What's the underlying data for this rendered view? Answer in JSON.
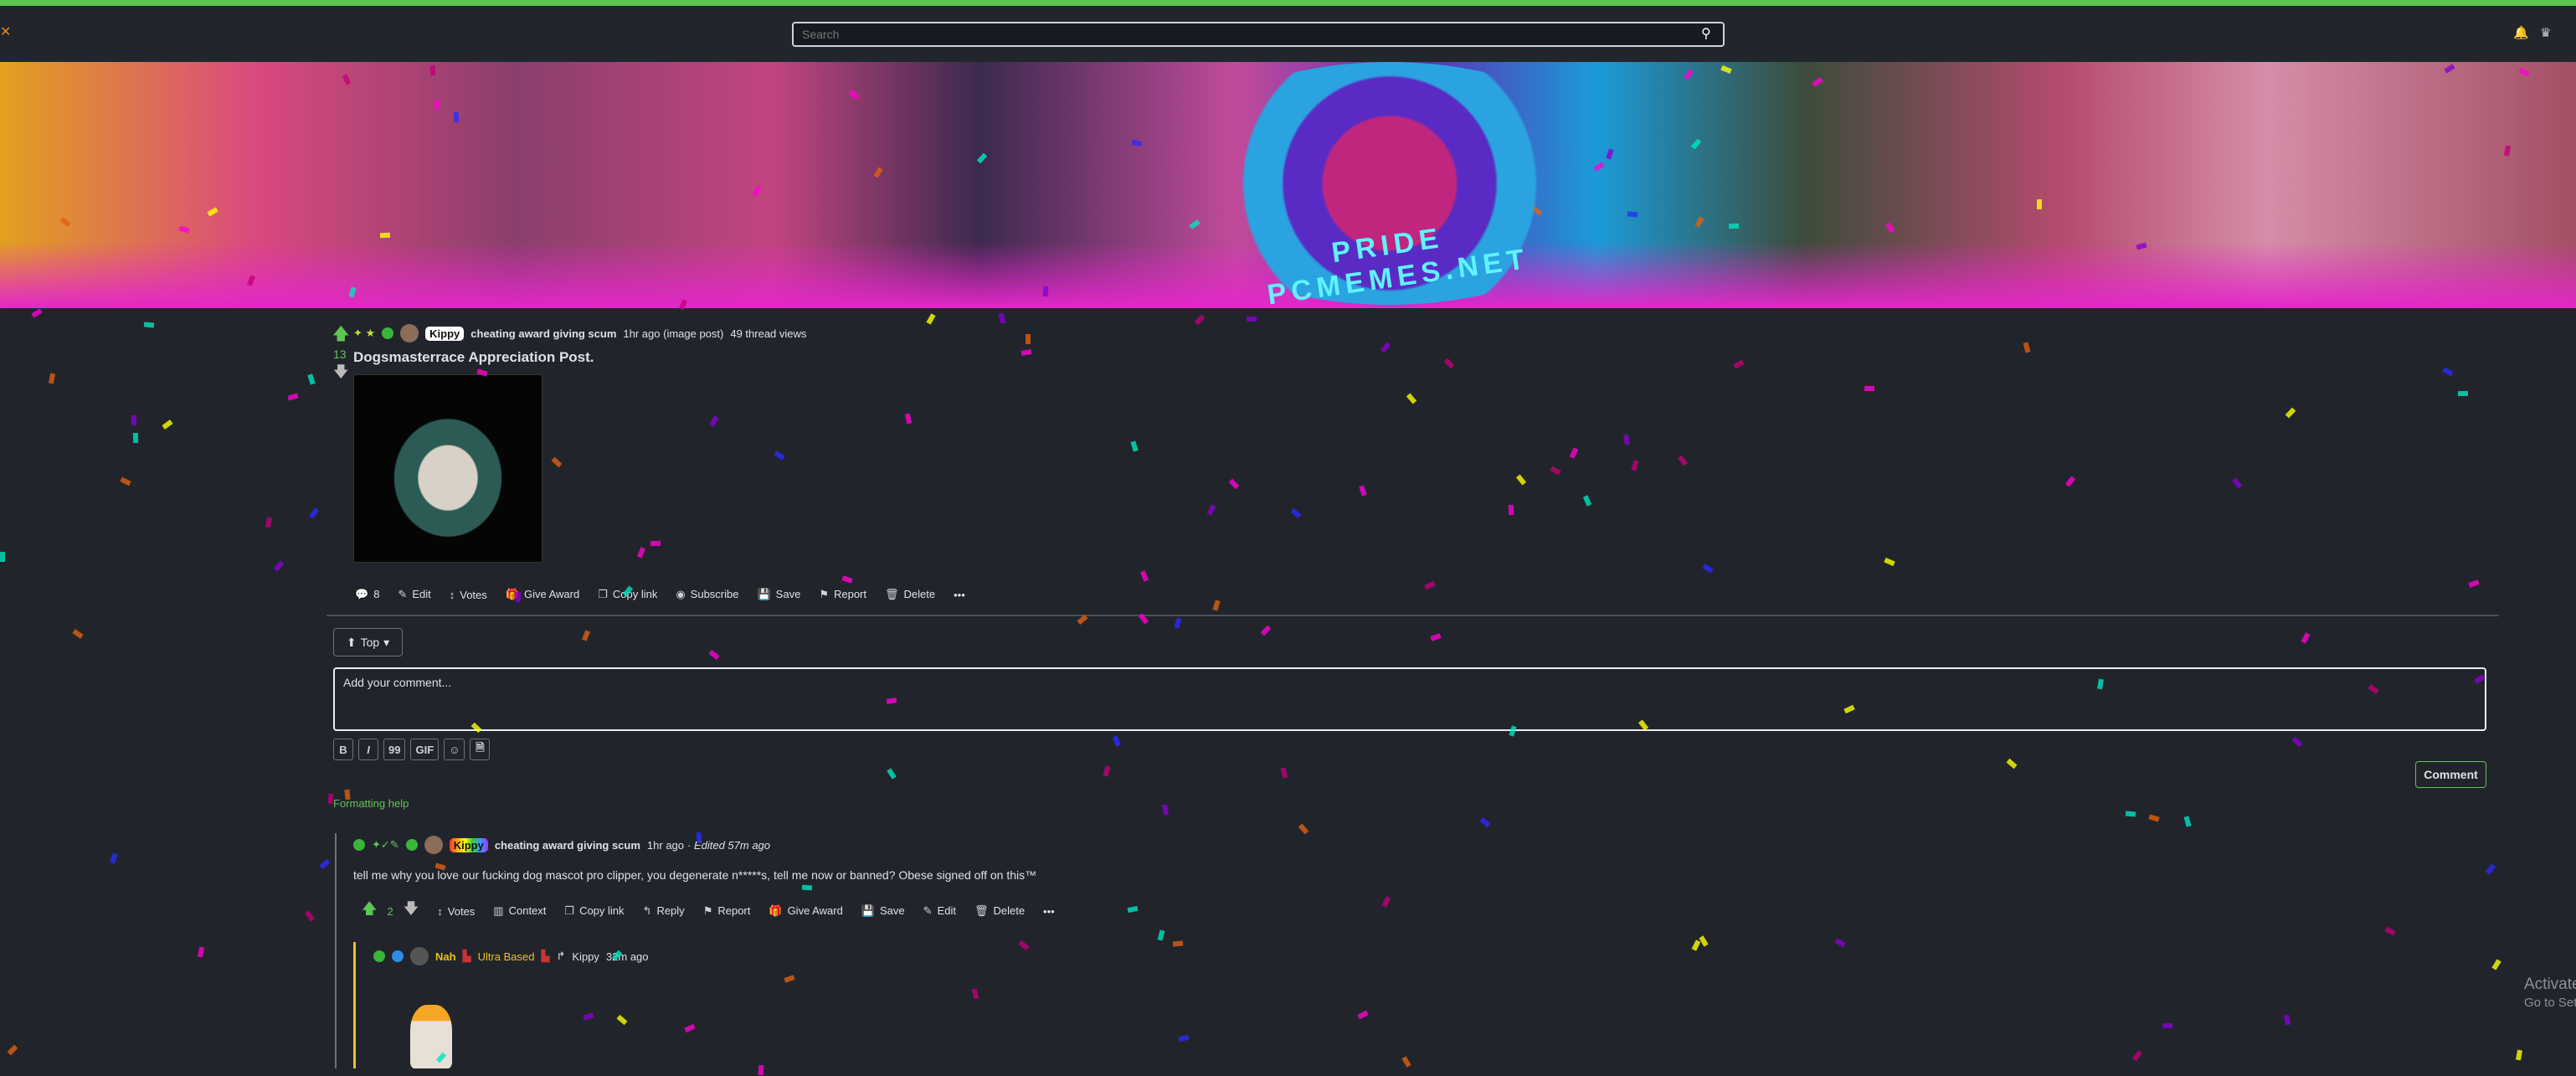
{
  "nav": {
    "search_placeholder": "Search",
    "icons": [
      "search-icon",
      "bell-icon",
      "user-icon"
    ]
  },
  "banner": {
    "logo_text": "PRIDE PCMEMES.NET"
  },
  "post": {
    "author_badge": "Kippy",
    "author_flair": "cheating award giving scum",
    "time": "1hr ago (image post)",
    "views": "49 thread views",
    "score": "13",
    "title": "Dogsmasterrace Appreciation Post.",
    "actions": [
      {
        "icon": "comment-icon",
        "label": "8"
      },
      {
        "icon": "edit-icon",
        "label": "Edit"
      },
      {
        "icon": "votes-icon",
        "label": "Votes"
      },
      {
        "icon": "gift-icon",
        "label": "Give Award"
      },
      {
        "icon": "copy-icon",
        "label": "Copy link"
      },
      {
        "icon": "eye-icon",
        "label": "Subscribe"
      },
      {
        "icon": "save-icon",
        "label": "Save"
      },
      {
        "icon": "flag-icon",
        "label": "Report"
      },
      {
        "icon": "trash-icon",
        "label": "Delete"
      },
      {
        "icon": "more-icon",
        "label": "•••"
      }
    ]
  },
  "comments_section": {
    "sort_label": "Top",
    "comment_placeholder": "Add your comment...",
    "format_buttons": [
      "B",
      "I",
      "99",
      "GIF",
      "☺",
      "🗎"
    ],
    "submit_label": "Comment",
    "formatting_help": "Formatting help"
  },
  "comment": {
    "author_badge": "Kippy",
    "author_flair": "cheating award giving scum",
    "time": "1hr ago",
    "edited": "· Edited 57m ago",
    "body": "tell me why you love our fucking dog mascot pro clipper, you degenerate n*****s, tell me now or banned? Obese signed off on this™",
    "score": "2",
    "actions": [
      {
        "icon": "votes-icon",
        "label": "Votes"
      },
      {
        "icon": "context-icon",
        "label": "Context"
      },
      {
        "icon": "copy-icon",
        "label": "Copy link"
      },
      {
        "icon": "reply-icon",
        "label": "Reply"
      },
      {
        "icon": "flag-icon",
        "label": "Report"
      },
      {
        "icon": "gift-icon",
        "label": "Give Award"
      },
      {
        "icon": "save-icon",
        "label": "Save"
      },
      {
        "icon": "edit-icon",
        "label": "Edit"
      },
      {
        "icon": "trash-icon",
        "label": "Delete"
      },
      {
        "icon": "more-icon",
        "label": "•••"
      }
    ]
  },
  "reply": {
    "author": "Nah",
    "flair": "Ultra Based",
    "reply_to": "Kippy",
    "time": "32m ago"
  },
  "watermark": {
    "line1": "Activate",
    "line2": "Go to Set"
  },
  "colors": {
    "accent": "#5fc555",
    "background": "#21252b",
    "reply_border": "#e9c21e"
  }
}
